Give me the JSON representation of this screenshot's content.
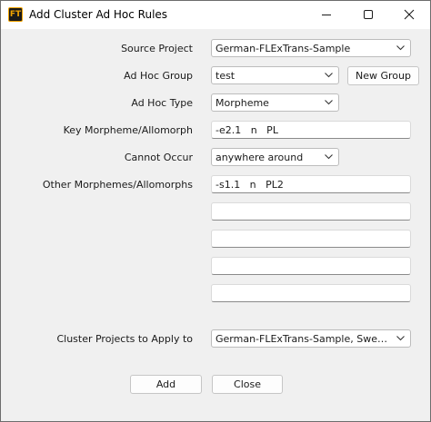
{
  "window": {
    "title": "Add Cluster Ad Hoc Rules",
    "app_icon_text": "FT",
    "controls": [
      "minimize-icon",
      "maximize-icon",
      "close-icon"
    ]
  },
  "form": {
    "source_project": {
      "label": "Source Project",
      "value": "German-FLExTrans-Sample"
    },
    "ad_hoc_group": {
      "label": "Ad Hoc Group",
      "value": "test",
      "new_group_label": "New Group"
    },
    "ad_hoc_type": {
      "label": "Ad Hoc Type",
      "value": "Morpheme"
    },
    "key_morpheme": {
      "label": "Key Morpheme/Allomorph",
      "value": "-e2.1   n   PL"
    },
    "cannot_occur": {
      "label": "Cannot Occur",
      "value": "anywhere around"
    },
    "other_morphemes": {
      "label": "Other Morphemes/Allomorphs",
      "values": [
        "-s1.1   n   PL2",
        "",
        "",
        "",
        ""
      ]
    },
    "cluster_projects": {
      "label": "Cluster Projects to Apply to",
      "value": "German-FLExTrans-Sample, Swedish-FLExTrans-Sample"
    }
  },
  "buttons": {
    "add": "Add",
    "close": "Close"
  },
  "colors": {
    "dialog_bg": "#f0f0f0",
    "titlebar_bg": "#ffffff",
    "icon_accent": "#f0a300"
  }
}
